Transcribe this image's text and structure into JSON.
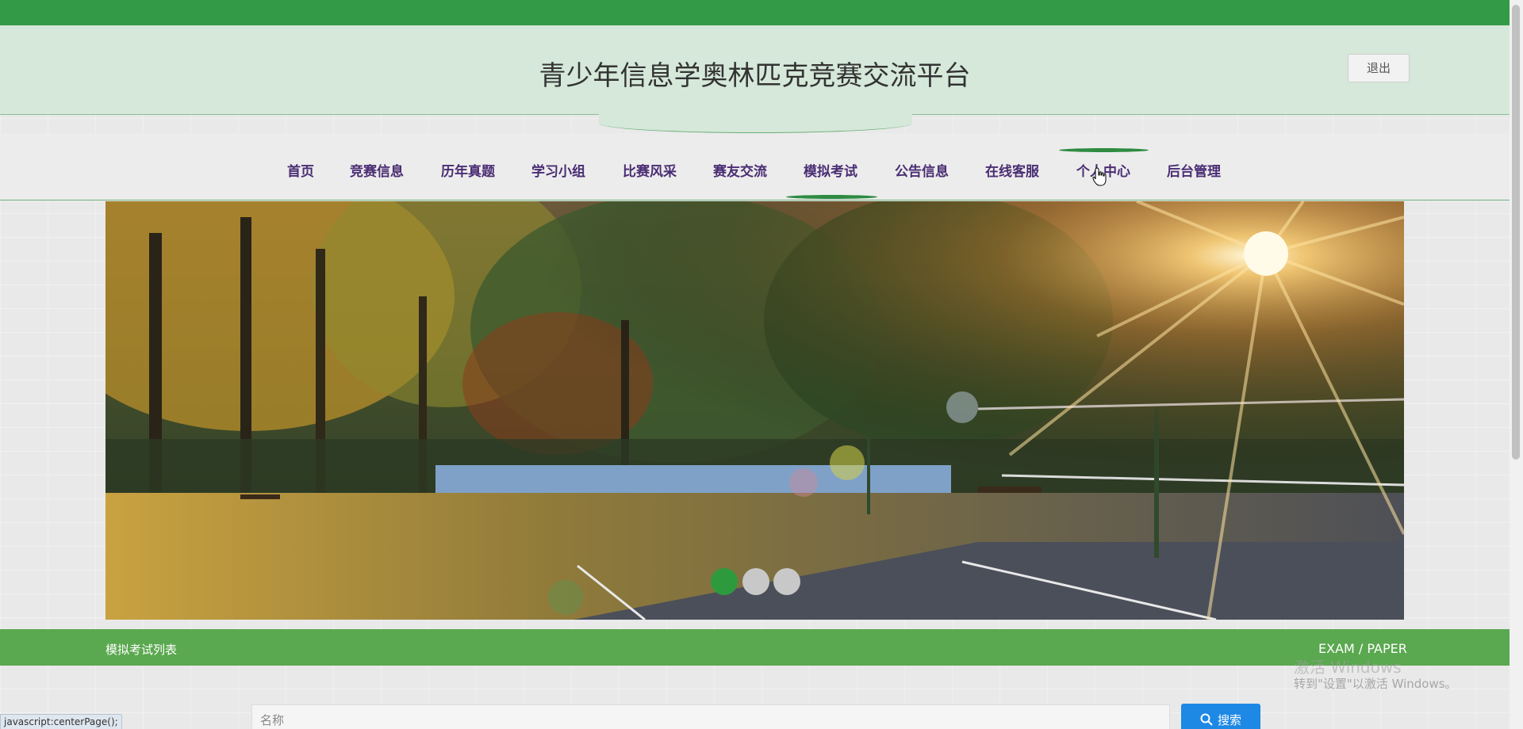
{
  "header": {
    "title": "青少年信息学奥林匹克竞赛交流平台",
    "logout_label": "退出"
  },
  "nav": {
    "items": [
      {
        "label": "首页"
      },
      {
        "label": "竞赛信息"
      },
      {
        "label": "历年真题"
      },
      {
        "label": "学习小组"
      },
      {
        "label": "比赛风采"
      },
      {
        "label": "赛友交流"
      },
      {
        "label": "模拟考试"
      },
      {
        "label": "公告信息"
      },
      {
        "label": "在线客服"
      },
      {
        "label": "个人中心"
      },
      {
        "label": "后台管理"
      }
    ],
    "active_label": "模拟考试",
    "hover_label": "个人中心"
  },
  "banner": {
    "slide_count": 3,
    "active_slide": 1,
    "active_dot_color": "#2e9a3e",
    "inactive_dot_color": "#c8c8c8"
  },
  "section": {
    "title": "模拟考试列表",
    "subtitle": "EXAM / PAPER"
  },
  "search": {
    "placeholder": "名称",
    "button_label": "搜索"
  },
  "watermark": {
    "line1": "激活 Windows",
    "line2": "转到\"设置\"以激活 Windows。"
  },
  "status_bar": {
    "text": "javascript:centerPage();"
  },
  "colors": {
    "brand_green": "#339a47",
    "section_green": "#5aa84f",
    "nav_text": "#4a2d73",
    "search_blue": "#1e88e5"
  }
}
